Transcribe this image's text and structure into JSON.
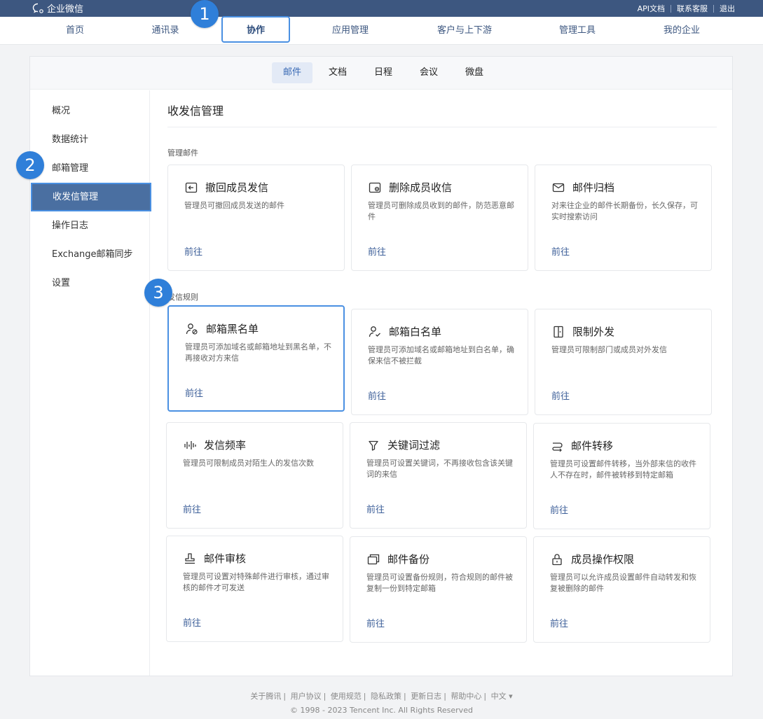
{
  "app": {
    "logo_text": "企业微信"
  },
  "toplinks": [
    "API文档",
    "联系客服",
    "退出"
  ],
  "mainnav": [
    "首页",
    "通讯录",
    "协作",
    "应用管理",
    "客户与上下游",
    "管理工具",
    "我的企业"
  ],
  "badges": [
    "1",
    "2",
    "3"
  ],
  "subtabs": [
    "邮件",
    "文档",
    "日程",
    "会议",
    "微盘"
  ],
  "sidebar": [
    "概况",
    "数据统计",
    "邮箱管理",
    "收发信管理",
    "操作日志",
    "Exchange邮箱同步",
    "设置"
  ],
  "content": {
    "title": "收发信管理",
    "section1": "管理邮件",
    "section2": "发信规则",
    "go_label": "前往"
  },
  "cards": [
    {
      "icon": "recall-icon",
      "title": "撤回成员发信",
      "desc": "管理员可撤回成员发送的邮件"
    },
    {
      "icon": "delete-mail-icon",
      "title": "删除成员收信",
      "desc": "管理员可删除成员收到的邮件，防范恶意邮件"
    },
    {
      "icon": "envelope-icon",
      "title": "邮件归档",
      "desc": "对来往企业的邮件长期备份，长久保存，可实时搜索访问"
    },
    {
      "icon": "user-block-icon",
      "title": "邮箱黑名单",
      "desc": "管理员可添加域名或邮箱地址到黑名单，不再接收对方来信"
    },
    {
      "icon": "user-check-icon",
      "title": "邮箱白名单",
      "desc": "管理员可添加域名或邮箱地址到白名单，确保来信不被拦截"
    },
    {
      "icon": "door-icon",
      "title": "限制外发",
      "desc": "管理员可限制部门或成员对外发信"
    },
    {
      "icon": "frequency-icon",
      "title": "发信频率",
      "desc": "管理员可限制成员对陌生人的发信次数"
    },
    {
      "icon": "filter-icon",
      "title": "关键词过滤",
      "desc": "管理员可设置关键词，不再接收包含该关键词的来信"
    },
    {
      "icon": "forward-icon",
      "title": "邮件转移",
      "desc": "管理员可设置邮件转移，当外部来信的收件人不存在时，邮件被转移到特定邮箱"
    },
    {
      "icon": "stamp-icon",
      "title": "邮件审核",
      "desc": "管理员可设置对特殊邮件进行审核，通过审核的邮件才可发送"
    },
    {
      "icon": "backup-icon",
      "title": "邮件备份",
      "desc": "管理员可设置备份规则，符合规则的邮件被复制一份到特定邮箱"
    },
    {
      "icon": "lock-icon",
      "title": "成员操作权限",
      "desc": "管理员可以允许成员设置邮件自动转发和恢复被删除的邮件"
    }
  ],
  "footer": {
    "links": [
      "关于腾讯",
      "用户协议",
      "使用规范",
      "隐私政策",
      "更新日志",
      "帮助中心",
      "中文 ▾"
    ],
    "copyright": "© 1998 - 2023 Tencent Inc. All Rights Reserved"
  }
}
